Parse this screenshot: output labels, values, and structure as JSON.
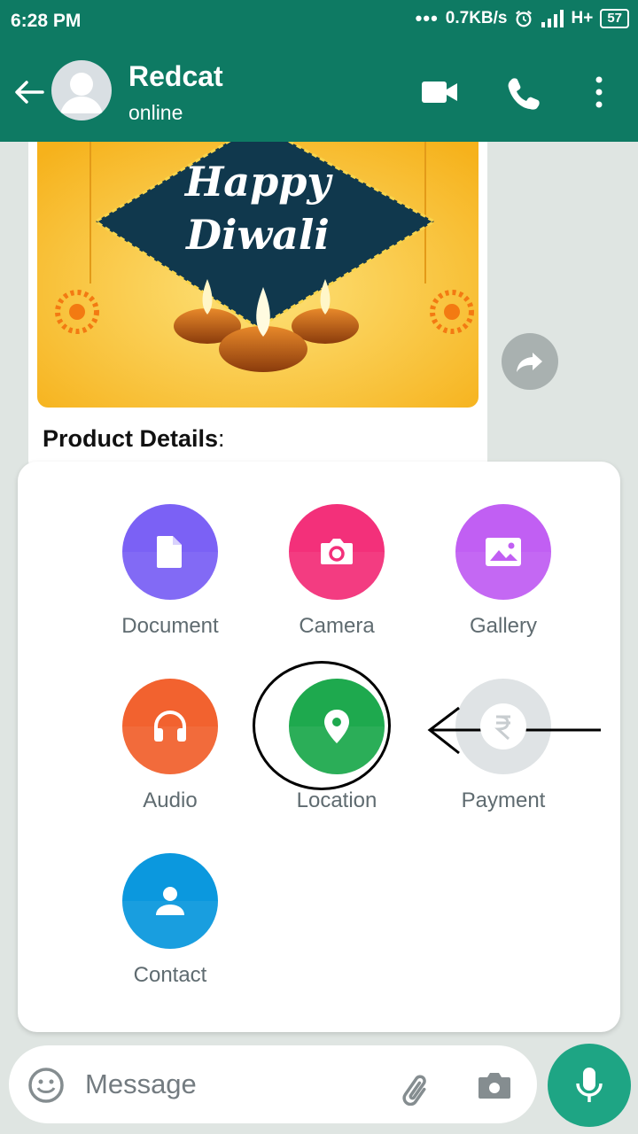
{
  "status_bar": {
    "time": "6:28 PM",
    "dots": "•••",
    "speed": "0.7KB/s",
    "network": "H+",
    "battery": "57"
  },
  "header": {
    "contact_name": "Redcat",
    "contact_status": "online",
    "icons": [
      "back-arrow-icon",
      "video-call-icon",
      "voice-call-icon",
      "more-options-icon"
    ],
    "color": "#0e7a63"
  },
  "chat": {
    "image_text_line1": "Happy",
    "image_text_line2": "Diwali",
    "product_label": "Product Details",
    "product_colon": ":"
  },
  "attachments": {
    "items": [
      {
        "label": "Document",
        "color": "#7b61f5",
        "icon": "document-icon"
      },
      {
        "label": "Camera",
        "color": "#f3307a",
        "icon": "camera-icon"
      },
      {
        "label": "Gallery",
        "color": "#c15ff3",
        "icon": "gallery-icon"
      },
      {
        "label": "Audio",
        "color": "#f2622f",
        "icon": "headphones-icon"
      },
      {
        "label": "Location",
        "color": "#1ea94e",
        "icon": "location-pin-icon"
      },
      {
        "label": "Payment",
        "color": "#dfe3e5",
        "icon": "rupee-icon"
      },
      {
        "label": "Contact",
        "color": "#0b98de",
        "icon": "person-icon"
      }
    ]
  },
  "input": {
    "placeholder": "Message",
    "accent_color": "#1ea584"
  }
}
